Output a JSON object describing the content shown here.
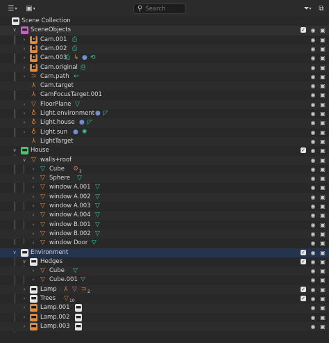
{
  "toolbar": {
    "display_mode_icon": "outliner-display-icon",
    "filter_view_icon": "view-layer-icon",
    "search_placeholder": "Search",
    "filter_icon": "funnel-icon",
    "new_collection_icon": "new-collection-icon"
  },
  "colors": {
    "object": "#e08a3c",
    "data": "#3cc59a",
    "pink_collection": "#c762c5",
    "green_collection": "#4ec276",
    "selected_row": "#24344f"
  },
  "rows": [
    {
      "label": "Scene Collection",
      "icon": "scene-collection-icon"
    },
    {
      "label": "SceneObjects",
      "icon": "collection-icon"
    },
    {
      "label": "Cam.001",
      "icon": "camera-object-icon"
    },
    {
      "label": "Cam.002",
      "icon": "camera-object-icon"
    },
    {
      "label": "Cam.003",
      "icon": "camera-object-icon"
    },
    {
      "label": "Cam.original",
      "icon": "camera-object-icon"
    },
    {
      "label": "Cam.path",
      "icon": "curve-object-icon"
    },
    {
      "label": "Cam.target",
      "icon": "empty-object-icon"
    },
    {
      "label": "CamFocusTarget.001",
      "icon": "empty-object-icon"
    },
    {
      "label": "FloorPlane",
      "icon": "mesh-object-icon"
    },
    {
      "label": "Light.environment",
      "icon": "light-object-icon"
    },
    {
      "label": "Light.house",
      "icon": "light-object-icon"
    },
    {
      "label": "Light.sun",
      "icon": "light-object-icon"
    },
    {
      "label": "LightTarget",
      "icon": "empty-object-icon"
    },
    {
      "label": "House",
      "icon": "collection-icon"
    },
    {
      "label": "walls+roof",
      "icon": "mesh-object-icon"
    },
    {
      "label": "Cube",
      "icon": "mesh-object-icon"
    },
    {
      "label": "Sphere",
      "icon": "mesh-object-icon"
    },
    {
      "label": "window A.001",
      "icon": "mesh-object-icon"
    },
    {
      "label": "window A.002",
      "icon": "mesh-object-icon"
    },
    {
      "label": "window A.003",
      "icon": "mesh-object-icon"
    },
    {
      "label": "window A.004",
      "icon": "mesh-object-icon"
    },
    {
      "label": "window B.001",
      "icon": "mesh-object-icon"
    },
    {
      "label": "window B.002",
      "icon": "mesh-object-icon"
    },
    {
      "label": "window Door",
      "icon": "mesh-object-icon"
    },
    {
      "label": "Environment",
      "icon": "collection-icon"
    },
    {
      "label": "Hedges",
      "icon": "collection-icon"
    },
    {
      "label": "Cube",
      "icon": "mesh-object-icon"
    },
    {
      "label": "Cube.001",
      "icon": "mesh-object-icon"
    },
    {
      "label": "Lamp",
      "icon": "collection-icon"
    },
    {
      "label": "Trees",
      "icon": "collection-icon"
    },
    {
      "label": "Lamp.001",
      "icon": "collection-instance-icon"
    },
    {
      "label": "Lamp.002",
      "icon": "collection-instance-icon"
    },
    {
      "label": "Lamp.003",
      "icon": "collection-instance-icon"
    }
  ],
  "badges": {
    "cube_children": "2",
    "lamp_children": "2",
    "trees_children": "10"
  }
}
